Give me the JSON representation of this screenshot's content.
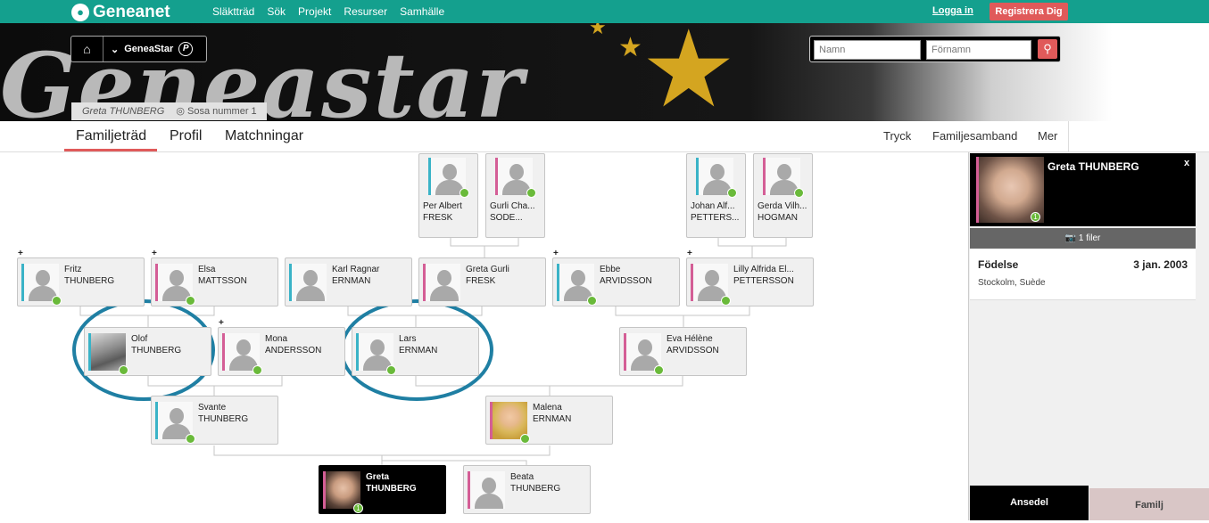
{
  "topbar": {
    "logo_text": "Geneanet",
    "nav": [
      "Släktträd",
      "Sök",
      "Projekt",
      "Resurser",
      "Samhälle"
    ],
    "login": "Logga in",
    "register": "Registrera Dig"
  },
  "banner": {
    "wordmark": "Geneastar",
    "nav_label": "GeneaStar",
    "search_placeholders": {
      "name": "Namn",
      "firstname": "Förnamn"
    },
    "person": "Greta THUNBERG",
    "sosa": "Sosa nummer 1"
  },
  "tabs": [
    "Familjeträd",
    "Profil",
    "Matchningar"
  ],
  "right_links": [
    "Tryck",
    "Familjesamband",
    "Mer"
  ],
  "tree": {
    "great_grandparents": [
      {
        "first": "Per Albert",
        "last": "FRESK"
      },
      {
        "first": "Gurli Cha...",
        "last": "SODE..."
      },
      {
        "first": "Johan Alf...",
        "last": "PETTERS..."
      },
      {
        "first": "Gerda Vilh...",
        "last": "HOGMAN"
      }
    ],
    "grandparents": [
      {
        "first": "Fritz",
        "last": "THUNBERG"
      },
      {
        "first": "Elsa",
        "last": "MATTSSON"
      },
      {
        "first": "Karl Ragnar",
        "last": "ERNMAN"
      },
      {
        "first": "Greta Gurli",
        "last": "FRESK"
      },
      {
        "first": "Ebbe",
        "last": "ARVIDSSON"
      },
      {
        "first": "Lilly Alfrida El...",
        "last": "PETTERSSON"
      }
    ],
    "parents_gen": [
      {
        "first": "Olof",
        "last": "THUNBERG"
      },
      {
        "first": "Mona",
        "last": "ANDERSSON"
      },
      {
        "first": "Lars",
        "last": "ERNMAN"
      },
      {
        "first": "Eva Hélène",
        "last": "ARVIDSSON"
      }
    ],
    "parents": [
      {
        "first": "Svante",
        "last": "THUNBERG"
      },
      {
        "first": "Malena",
        "last": "ERNMAN"
      }
    ],
    "root": {
      "first": "Greta",
      "last": "THUNBERG"
    },
    "sibling": {
      "first": "Beata",
      "last": "THUNBERG"
    },
    "plus": "+",
    "badge_number": "1"
  },
  "panel": {
    "name": "Greta THUNBERG",
    "close": "x",
    "files": "1 filer",
    "birth_label": "Födelse",
    "birth_date": "3 jan. 2003",
    "birth_place": "Stockolm, Suède",
    "tab_active": "Ansedel",
    "tab_other": "Familj"
  },
  "colors": {
    "brand": "#14a08e",
    "accent": "#e05a5a",
    "male": "#3ab3c7",
    "female": "#d45e96",
    "highlight_circle": "#1f7fa3"
  }
}
